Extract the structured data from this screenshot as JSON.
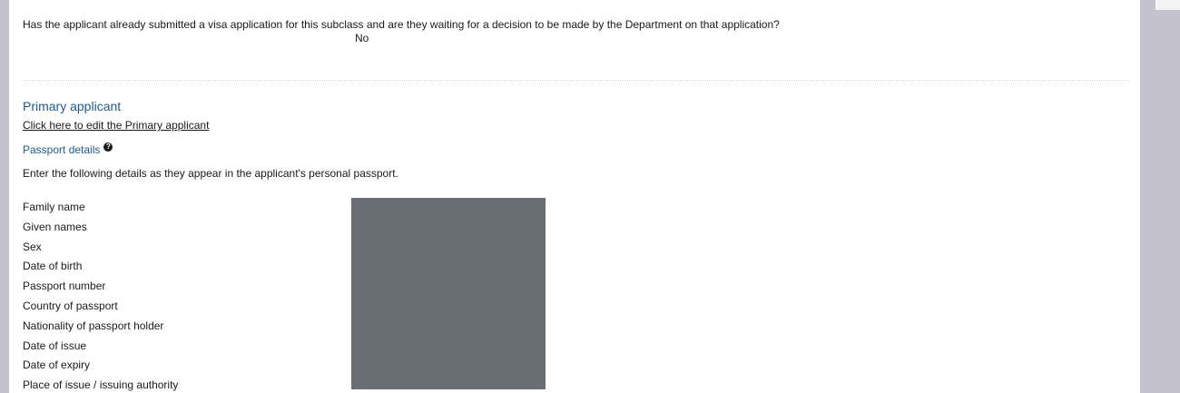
{
  "form": {
    "question": "Has the applicant already submitted a visa application for this subclass and are they waiting for a decision to be made by the Department on that application?",
    "answer": "No"
  },
  "primary_applicant": {
    "title": "Primary applicant",
    "edit_link": "Click here to edit the Primary applicant",
    "passport": {
      "title": "Passport details",
      "help_icon": "question-circle-icon",
      "instructions": "Enter the following details as they appear in the applicant's personal passport.",
      "fields": [
        "Family name",
        "Given names",
        "Sex",
        "Date of birth",
        "Passport number",
        "Country of passport",
        "Nationality of passport holder",
        "Date of issue",
        "Date of expiry",
        "Place of issue / issuing authority"
      ]
    }
  },
  "colors": {
    "heading": "#1f5a8c",
    "redaction": "#686e74",
    "frame": "#c3c2cd"
  }
}
